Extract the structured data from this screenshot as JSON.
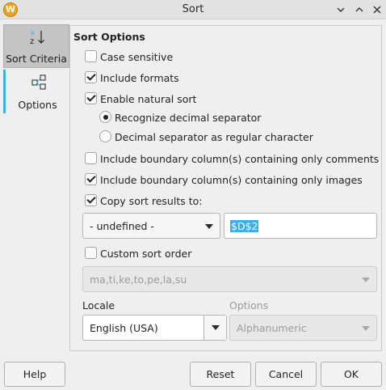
{
  "window": {
    "title": "Sort",
    "app_icon_letter": "W",
    "minimize_icon": "chevron-down-icon",
    "maximize_icon": "chevron-up-icon",
    "close_icon": "close-icon"
  },
  "nav": {
    "items": [
      {
        "label": "Sort Criteria",
        "icon": "sort-az-icon",
        "active": true
      },
      {
        "label": "Options",
        "icon": "options-icon",
        "active": false
      }
    ]
  },
  "options": {
    "section_title": "Sort Options",
    "case_sensitive": {
      "label": "Case sensitive",
      "checked": false
    },
    "include_formats": {
      "label": "Include formats",
      "checked": true
    },
    "natural_sort": {
      "label": "Enable natural sort",
      "checked": true
    },
    "radio_decimal": {
      "label": "Recognize decimal separator",
      "selected": true
    },
    "radio_regular": {
      "label": "Decimal separator as regular character",
      "selected": false
    },
    "boundary_comments": {
      "label": "Include boundary column(s) containing only comments",
      "checked": false
    },
    "boundary_images": {
      "label": "Include boundary column(s) containing only images",
      "checked": true
    },
    "copy_results": {
      "label": "Copy sort results to:",
      "checked": true
    },
    "copy_target_select": "- undefined -",
    "copy_target_value": "$D$2",
    "custom_order": {
      "label": "Custom sort order",
      "checked": false
    },
    "custom_order_select": "ma,ti,ke,to,pe,la,su",
    "locale_label": "Locale",
    "locale_value": "English (USA)",
    "algorithm_label": "Options",
    "algorithm_value": "Alphanumeric"
  },
  "buttons": {
    "help": "Help",
    "reset": "Reset",
    "cancel": "Cancel",
    "ok": "OK"
  },
  "colors": {
    "accent": "#3daee9",
    "app_icon": "#f0a21a"
  }
}
